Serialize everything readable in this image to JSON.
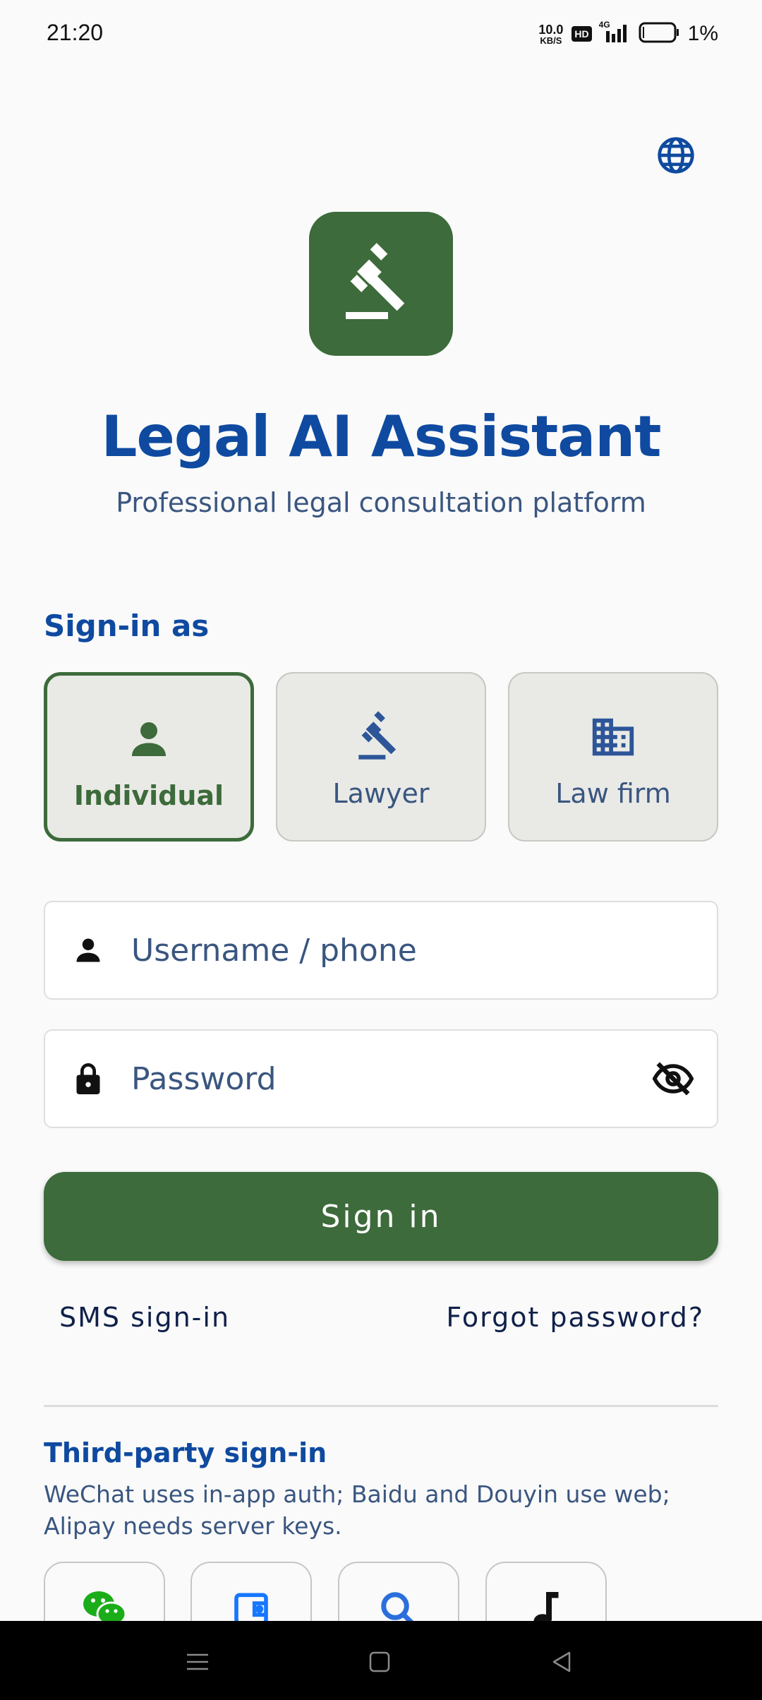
{
  "status_bar": {
    "time": "21:20",
    "net_speed_value": "10.0",
    "net_speed_unit": "KB/S",
    "hd_badge": "HD",
    "network_type": "4G",
    "battery_percent": "1%"
  },
  "app": {
    "title": "Legal AI Assistant",
    "subtitle": "Professional legal consultation platform"
  },
  "sign_in_as": {
    "heading": "Sign-in as",
    "roles": [
      {
        "label": "Individual",
        "icon": "person-icon",
        "selected": true
      },
      {
        "label": "Lawyer",
        "icon": "gavel-icon",
        "selected": false
      },
      {
        "label": "Law firm",
        "icon": "building-icon",
        "selected": false
      }
    ]
  },
  "form": {
    "username_placeholder": "Username / phone",
    "username_value": "",
    "password_placeholder": "Password",
    "password_value": "",
    "signin_label": "Sign in",
    "sms_link": "SMS sign-in",
    "forgot_link": "Forgot password?"
  },
  "third_party": {
    "heading": "Third-party sign-in",
    "description": "WeChat uses in-app auth; Baidu and Douyin use web; Alipay needs server keys.",
    "providers": [
      {
        "icon": "wechat-icon",
        "color": "#1aad19"
      },
      {
        "icon": "wallet-icon",
        "color": "#1677ff"
      },
      {
        "icon": "search-icon",
        "color": "#2a6fdb"
      },
      {
        "icon": "music-note-icon",
        "color": "#111111"
      }
    ]
  },
  "colors": {
    "primary": "#3d6b3b",
    "accent_blue": "#0f4aa0",
    "text_muted": "#3a5680"
  }
}
